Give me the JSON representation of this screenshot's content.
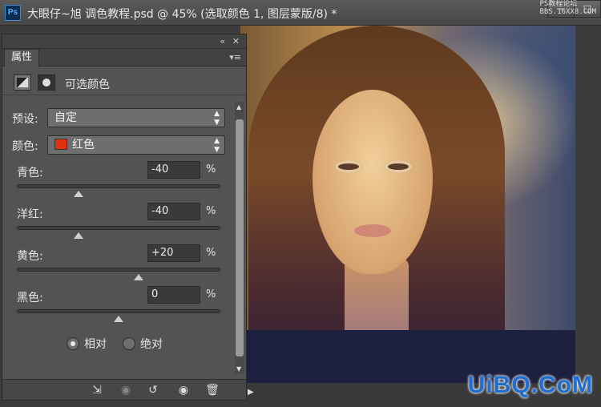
{
  "titlebar": {
    "app_icon": "Ps",
    "document_title": "大眼仔~旭 调色教程.psd @ 45% (选取颜色 1, 图层蒙版/8) *",
    "window_buttons": [
      "—",
      "□"
    ],
    "watermark": [
      "PS教程论坛",
      "BBS.16XX8.COM"
    ]
  },
  "panel": {
    "collapse_icon": "«",
    "close_icon": "✕",
    "tab_label": "属性",
    "menu_icon": "▾≡",
    "header_title": "可选颜色",
    "preset": {
      "label": "预设:",
      "value": "自定"
    },
    "color": {
      "label": "颜色:",
      "value": "红色",
      "swatch": "#e03212"
    },
    "sliders": [
      {
        "label": "青色:",
        "value": "-40",
        "unit": "%",
        "level": 0.3
      },
      {
        "label": "洋红:",
        "value": "-40",
        "unit": "%",
        "level": 0.3
      },
      {
        "label": "黄色:",
        "value": "+20",
        "unit": "%",
        "level": 0.6
      },
      {
        "label": "黑色:",
        "value": "0",
        "unit": "%",
        "level": 0.5
      }
    ],
    "method": {
      "options": [
        "相对",
        "绝对"
      ],
      "selected": "相对"
    },
    "bottom_icons": [
      "clip-to-layer-icon",
      "view-previous-icon",
      "reset-icon",
      "visibility-eye-icon",
      "trash-icon"
    ]
  },
  "brand": "UiBQ.CoM"
}
